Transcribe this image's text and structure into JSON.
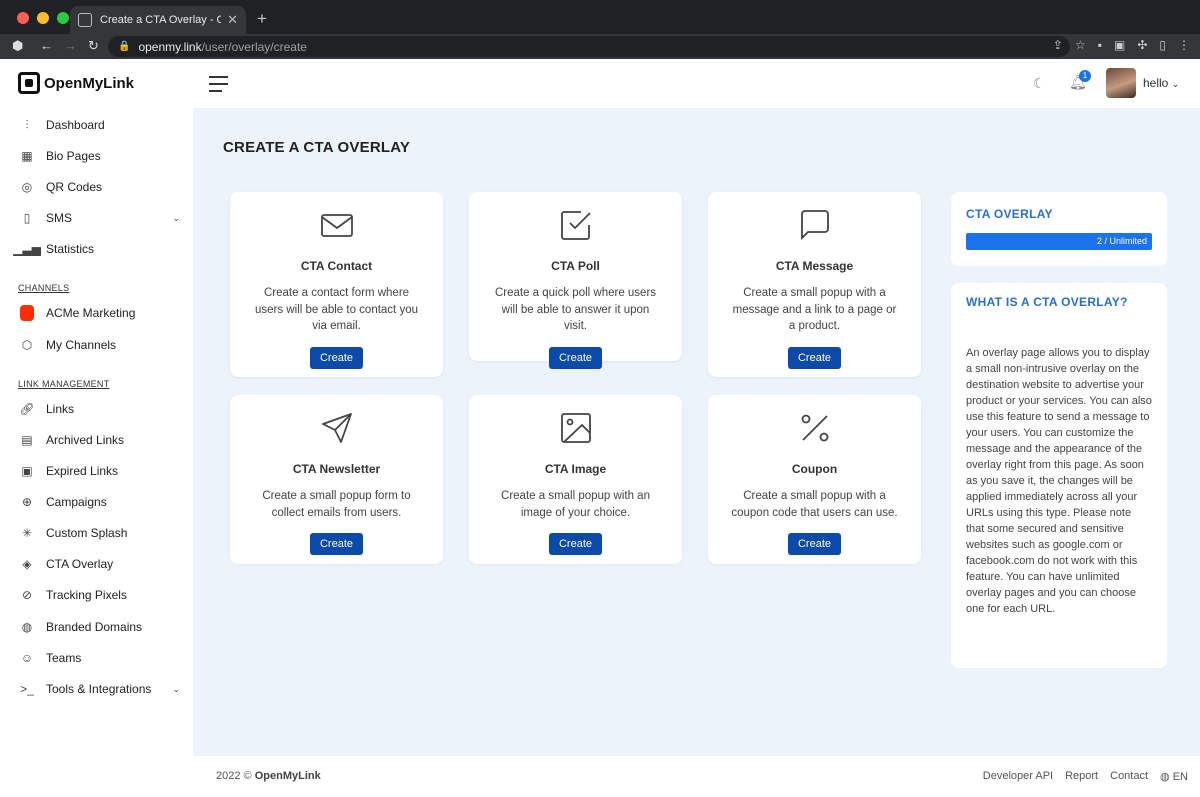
{
  "browser": {
    "tab_title": "Create a CTA Overlay - OpenMyLink",
    "url_domain": "openmy.link",
    "url_path": "/user/overlay/create"
  },
  "app": {
    "name": "OpenMyLink"
  },
  "header": {
    "username": "hello",
    "notification_count": "1"
  },
  "sidebar": {
    "items": [
      {
        "label": "Dashboard",
        "icon": "sliders-icon"
      },
      {
        "label": "Bio Pages",
        "icon": "layout-icon"
      },
      {
        "label": "QR Codes",
        "icon": "aperture-icon"
      },
      {
        "label": "SMS",
        "icon": "phone-icon"
      },
      {
        "label": "Statistics",
        "icon": "bar-chart-icon"
      }
    ],
    "channels_heading": "CHANNELS",
    "channels": [
      {
        "label": "ACMe Marketing",
        "color": "#ff2d00"
      },
      {
        "label": "My Channels",
        "icon": "box-icon"
      }
    ],
    "link_heading": "LINK MANAGEMENT",
    "links": [
      {
        "label": "Links"
      },
      {
        "label": "Archived Links"
      },
      {
        "label": "Expired Links"
      },
      {
        "label": "Campaigns"
      },
      {
        "label": "Custom Splash"
      },
      {
        "label": "CTA Overlay"
      },
      {
        "label": "Tracking Pixels"
      },
      {
        "label": "Branded Domains"
      },
      {
        "label": "Teams"
      },
      {
        "label": "Tools & Integrations"
      }
    ]
  },
  "main": {
    "title": "CREATE A CTA OVERLAY",
    "cards": [
      {
        "title": "CTA Contact",
        "desc": "Create a contact form where users will be able to contact you via email.",
        "button": "Create",
        "icon": "mail-icon"
      },
      {
        "title": "CTA Poll",
        "desc": "Create a quick poll where users will be able to answer it upon visit.",
        "button": "Create",
        "icon": "check-square-icon"
      },
      {
        "title": "CTA Message",
        "desc": "Create a small popup with a message and a link to a page or a product.",
        "button": "Create",
        "icon": "message-icon"
      },
      {
        "title": "CTA Newsletter",
        "desc": "Create a small popup form to collect emails from users.",
        "button": "Create",
        "icon": "send-icon"
      },
      {
        "title": "CTA Image",
        "desc": "Create a small popup with an image of your choice.",
        "button": "Create",
        "icon": "image-icon"
      },
      {
        "title": "Coupon",
        "desc": "Create a small popup with a coupon code that users can use.",
        "button": "Create",
        "icon": "percent-icon"
      }
    ],
    "usage": {
      "title": "CTA OVERLAY",
      "value": "2 / Unlimited",
      "fill": 1.0
    },
    "info": {
      "title": "WHAT IS A CTA OVERLAY?",
      "text": "An overlay page allows you to display a small non-intrusive overlay on the destination website to advertise your product or your services. You can also use this feature to send a message to your users. You can customize the message and the appearance of the overlay right from this page. As soon as you save it, the changes will be applied immediately across all your URLs using this type. Please note that some secured and sensitive websites such as google.com or facebook.com do not work with this feature. You can have unlimited overlay pages and you can choose one for each URL."
    }
  },
  "footer": {
    "year": "2022 ©",
    "brand": "OpenMyLink",
    "links": [
      "Developer API",
      "Report",
      "Contact"
    ],
    "lang": "EN"
  },
  "colors": {
    "accent": "#0b4aa8",
    "progress": "#1a73e8",
    "bg": "#edf3fb"
  }
}
